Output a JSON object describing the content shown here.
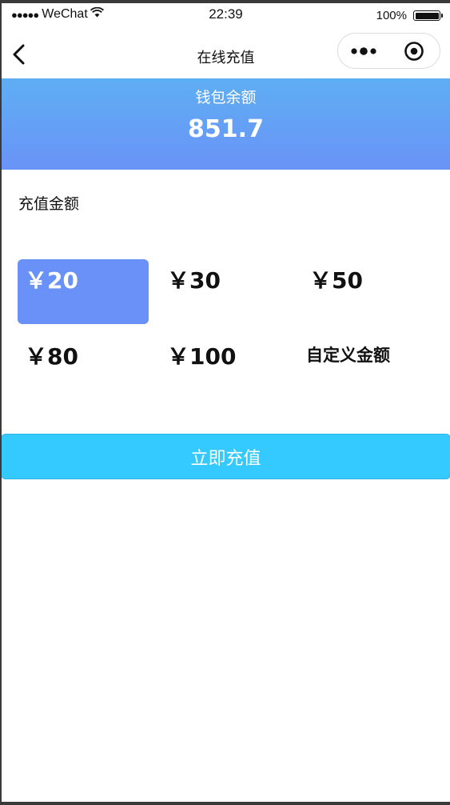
{
  "status_bar": {
    "signal": "●●●●●",
    "carrier": "WeChat",
    "time": "22:39",
    "battery": "100%"
  },
  "nav": {
    "title": "在线充值",
    "more_icon": "more-dots-icon",
    "close_icon": "target-close-icon",
    "back_icon": "chevron-left-icon"
  },
  "balance": {
    "label": "钱包余额",
    "value": "851.7"
  },
  "recharge": {
    "section_label": "充值金额",
    "options": [
      {
        "label": "￥20",
        "selected": true
      },
      {
        "label": "￥30",
        "selected": false
      },
      {
        "label": "￥50",
        "selected": false
      },
      {
        "label": "￥80",
        "selected": false
      },
      {
        "label": "￥100",
        "selected": false
      },
      {
        "label": "自定义金额",
        "selected": false
      }
    ],
    "submit_label": "立即充值"
  },
  "colors": {
    "banner_top": "#5eaef3",
    "banner_bottom": "#6a93f7",
    "selected_option": "#6a91f7",
    "submit_button": "#34c9ff"
  }
}
